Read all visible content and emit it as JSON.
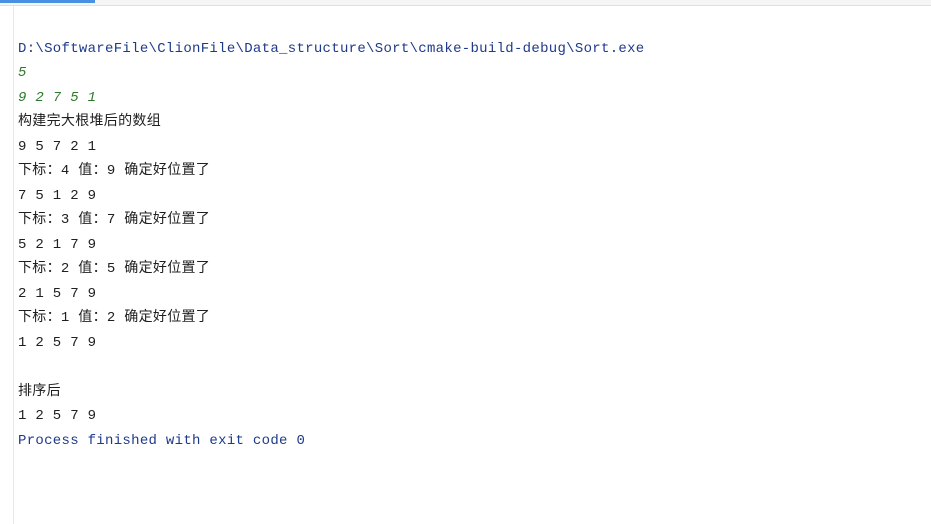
{
  "console": {
    "path": "D:\\SoftwareFile\\ClionFile\\Data_structure\\Sort\\cmake-build-debug\\Sort.exe",
    "input1": "5",
    "input2": "9 2 7 5 1",
    "out1": "构建完大根堆后的数组",
    "out2": "9 5 7 2 1",
    "out3": "下标：4 值：9 确定好位置了",
    "out4": "7 5 1 2 9",
    "out5": "下标：3 值：7 确定好位置了",
    "out6": "5 2 1 7 9",
    "out7": "下标：2 值：5 确定好位置了",
    "out8": "2 1 5 7 9",
    "out9": "下标：1 值：2 确定好位置了",
    "out10": "1 2 5 7 9",
    "out11": "",
    "out12": "排序后",
    "out13": "1 2 5 7 9",
    "exit": "Process finished with exit code 0"
  }
}
